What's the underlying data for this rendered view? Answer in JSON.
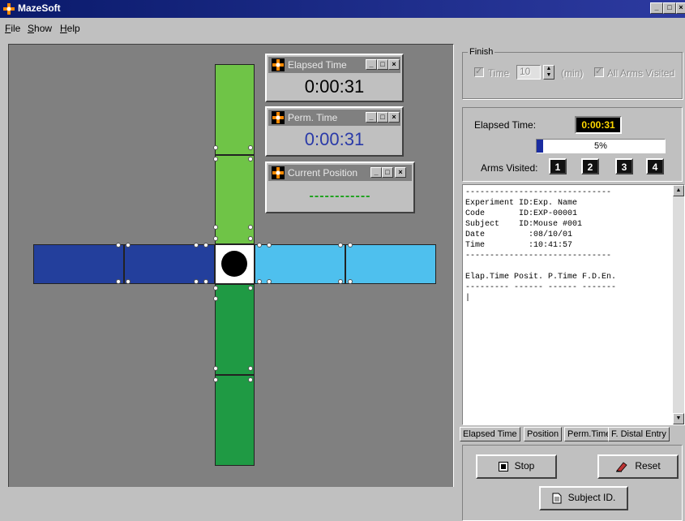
{
  "window": {
    "title": "MazeSoft",
    "minimize": "_",
    "maximize": "□",
    "close": "×"
  },
  "menu": [
    {
      "label": "File",
      "underline": "F",
      "rest": "ile"
    },
    {
      "label": "Show",
      "underline": "S",
      "rest": "how"
    },
    {
      "label": "Help",
      "underline": "H",
      "rest": "elp"
    }
  ],
  "colors": {
    "north_arm": "#6fc447",
    "south_arm": "#1f9a44",
    "west_arm": "#233f9c",
    "east_arm": "#4ec0ee",
    "maze_bg": "#808080"
  },
  "mini_windows": {
    "elapsed": {
      "title": "Elapsed Time",
      "value": "0:00:31",
      "value_color": "#000000"
    },
    "perm": {
      "title": "Perm. Time",
      "value": "0:00:31",
      "value_color": "#2a3aa8"
    },
    "position": {
      "title": "Current Position",
      "value": "------------",
      "value_color": "#1aa01a"
    }
  },
  "finish": {
    "legend": "Finish",
    "time_label": "Time",
    "time_value": "10",
    "time_unit": "(min)",
    "all_arms_label": "All Arms Visited"
  },
  "status": {
    "elapsed_label": "Elapsed Time:",
    "elapsed_value": "0:00:31",
    "progress_percent": 5,
    "progress_text": "5%",
    "arms_label": "Arms Visited:",
    "arms": [
      "1",
      "2",
      "3",
      "4"
    ]
  },
  "log_lines": [
    "------------------------------",
    "Experiment ID:Exp. Name",
    "Code       ID:EXP-00001",
    "Subject    ID:Mouse #001",
    "Date         :08/10/01",
    "Time         :10:41:57",
    "------------------------------",
    "",
    "Elap.Time Posit. P.Time F.D.En.",
    "--------- ------ ------ -------",
    "|"
  ],
  "tabs": [
    "Elapsed Time",
    "Position",
    "Perm.Time",
    "F. Distal Entry"
  ],
  "buttons": {
    "stop": "Stop",
    "reset": "Reset",
    "subject_id": "Subject ID."
  }
}
